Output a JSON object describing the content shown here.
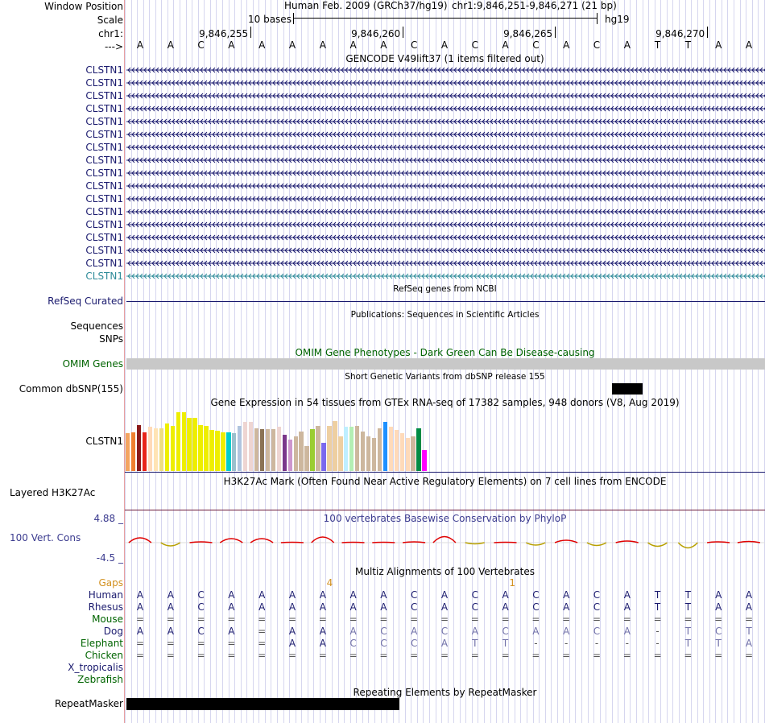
{
  "header": {
    "window_position_label": "Window Position",
    "scale_label": "Scale",
    "chrom_label": "chr1:",
    "strand_label": "--->",
    "assembly": "Human Feb. 2009 (GRCh37/hg19)",
    "position": "chr1:9,846,251-9,846,271 (21 bp)",
    "scale_text": "10 bases",
    "db_label": "hg19",
    "ticks": [
      "9,846,255",
      "9,846,260",
      "9,846,265",
      "9,846,270"
    ]
  },
  "sequence": [
    "A",
    "A",
    "C",
    "A",
    "A",
    "A",
    "A",
    "A",
    "A",
    "C",
    "A",
    "C",
    "A",
    "C",
    "A",
    "C",
    "A",
    "T",
    "T",
    "A",
    "A"
  ],
  "gencode": {
    "title": "GENCODE V49lift37 (1 items filtered out)",
    "transcripts": [
      "CLSTN1",
      "CLSTN1",
      "CLSTN1",
      "CLSTN1",
      "CLSTN1",
      "CLSTN1",
      "CLSTN1",
      "CLSTN1",
      "CLSTN1",
      "CLSTN1",
      "CLSTN1",
      "CLSTN1",
      "CLSTN1",
      "CLSTN1",
      "CLSTN1",
      "CLSTN1",
      "CLSTN1"
    ],
    "color": "#1a1a6e",
    "last_color": "#2e8b99"
  },
  "refseq": {
    "title": "RefSeq genes from NCBI",
    "label": "RefSeq Curated"
  },
  "publications": {
    "title": "Publications: Sequences in Scientific Articles",
    "label1": "Sequences",
    "label2": "SNPs"
  },
  "omim": {
    "title": "OMIM Gene Phenotypes - Dark Green Can Be Disease-causing",
    "label": "OMIM Genes",
    "color": "#006400"
  },
  "dbsnp": {
    "title": "Short Genetic Variants from dbSNP release 155",
    "label": "Common dbSNP(155)"
  },
  "gtex": {
    "title": "Gene Expression in 54 tissues from GTEx RNA-seq of 17382 samples, 948 donors (V8, Aug 2019)",
    "label": "CLSTN1",
    "bars": [
      {
        "v": 0.6,
        "c": "#f4a460"
      },
      {
        "v": 0.62,
        "c": "#f08030"
      },
      {
        "v": 0.73,
        "c": "#8b1a1a"
      },
      {
        "v": 0.62,
        "c": "#e8241a"
      },
      {
        "v": 0.7,
        "c": "#ffdab9"
      },
      {
        "v": 0.68,
        "c": "#ffe4b5"
      },
      {
        "v": 0.68,
        "c": "#eedd82"
      },
      {
        "v": 0.75,
        "c": "#eeee00"
      },
      {
        "v": 0.72,
        "c": "#eeee00"
      },
      {
        "v": 0.93,
        "c": "#eeee00"
      },
      {
        "v": 0.93,
        "c": "#eeee00"
      },
      {
        "v": 0.85,
        "c": "#eeee00"
      },
      {
        "v": 0.85,
        "c": "#eeee00"
      },
      {
        "v": 0.73,
        "c": "#eeee00"
      },
      {
        "v": 0.72,
        "c": "#eeee00"
      },
      {
        "v": 0.65,
        "c": "#eeee00"
      },
      {
        "v": 0.64,
        "c": "#eeee00"
      },
      {
        "v": 0.62,
        "c": "#eeee00"
      },
      {
        "v": 0.62,
        "c": "#00cdcd"
      },
      {
        "v": 0.6,
        "c": "#9ac0cd"
      },
      {
        "v": 0.72,
        "c": "#b0c4de"
      },
      {
        "v": 0.78,
        "c": "#eed5d2"
      },
      {
        "v": 0.78,
        "c": "#eed5d2"
      },
      {
        "v": 0.68,
        "c": "#cdb79e"
      },
      {
        "v": 0.67,
        "c": "#8b7355"
      },
      {
        "v": 0.67,
        "c": "#cdb79e"
      },
      {
        "v": 0.67,
        "c": "#cdb79e"
      },
      {
        "v": 0.7,
        "c": "#eed5d2"
      },
      {
        "v": 0.58,
        "c": "#7a378b"
      },
      {
        "v": 0.5,
        "c": "#cd96cd"
      },
      {
        "v": 0.55,
        "c": "#cdb79e"
      },
      {
        "v": 0.63,
        "c": "#cdb79e"
      },
      {
        "v": 0.4,
        "c": "#cdb79e"
      },
      {
        "v": 0.67,
        "c": "#9acd32"
      },
      {
        "v": 0.72,
        "c": "#cdb79e"
      },
      {
        "v": 0.45,
        "c": "#7b68ee"
      },
      {
        "v": 0.72,
        "c": "#eecfa1"
      },
      {
        "v": 0.8,
        "c": "#eecfa1"
      },
      {
        "v": 0.55,
        "c": "#eecfa1"
      },
      {
        "v": 0.7,
        "c": "#bfefff"
      },
      {
        "v": 0.7,
        "c": "#b4eeb4"
      },
      {
        "v": 0.72,
        "c": "#cdb79e"
      },
      {
        "v": 0.63,
        "c": "#cdb79e"
      },
      {
        "v": 0.55,
        "c": "#cdb79e"
      },
      {
        "v": 0.52,
        "c": "#cdb79e"
      },
      {
        "v": 0.68,
        "c": "#cdb79e"
      },
      {
        "v": 0.78,
        "c": "#1e90ff"
      },
      {
        "v": 0.7,
        "c": "#ffdab9"
      },
      {
        "v": 0.65,
        "c": "#ffdab9"
      },
      {
        "v": 0.6,
        "c": "#ffdab9"
      },
      {
        "v": 0.52,
        "c": "#ffdab9"
      },
      {
        "v": 0.55,
        "c": "#cdb79e"
      },
      {
        "v": 0.68,
        "c": "#008b45"
      },
      {
        "v": 0.33,
        "c": "#ff00ff"
      }
    ]
  },
  "h3k27ac": {
    "title": "H3K27Ac Mark (Often Found Near Active Regulatory Elements) on 7 cell lines from ENCODE",
    "label": "Layered H3K27Ac"
  },
  "phylop": {
    "title": "100 vertebrates Basewise Conservation by PhyloP",
    "label": "100 Vert. Cons",
    "ymax": "4.88 _",
    "ymin": "-4.5 _",
    "scores": [
      1.2,
      -0.8,
      0.2,
      1.0,
      1.0,
      0.1,
      1.4,
      0.1,
      0.1,
      0.2,
      1.5,
      -0.3,
      0.1,
      -0.6,
      0.6,
      -0.7,
      0.4,
      -0.9,
      -1.3,
      0.2,
      0.3
    ]
  },
  "multiz": {
    "title": "Multiz Alignments of 100 Vertebrates",
    "gaps_label": "Gaps",
    "gap_marks": [
      {
        "pos": 7,
        "text": "4"
      },
      {
        "pos": 13,
        "text": "1"
      }
    ],
    "species": [
      {
        "name": "Human",
        "color": "#1a1a6e",
        "seq": [
          "A",
          "A",
          "C",
          "A",
          "A",
          "A",
          "A",
          "A",
          "A",
          "C",
          "A",
          "C",
          "A",
          "C",
          "A",
          "C",
          "A",
          "T",
          "T",
          "A",
          "A"
        ]
      },
      {
        "name": "Rhesus",
        "color": "#1a1a6e",
        "seq": [
          "A",
          "A",
          "C",
          "A",
          "A",
          "A",
          "A",
          "A",
          "A",
          "C",
          "A",
          "C",
          "A",
          "C",
          "A",
          "C",
          "A",
          "T",
          "T",
          "A",
          "A"
        ]
      },
      {
        "name": "Mouse",
        "color": "#006400",
        "seq": [
          "=",
          "=",
          "=",
          "=",
          "=",
          "=",
          "=",
          "=",
          "=",
          "=",
          "=",
          "=",
          "=",
          "=",
          "=",
          "=",
          "=",
          "=",
          "=",
          "=",
          "="
        ]
      },
      {
        "name": "Dog",
        "color": "#1a1a6e",
        "seq": [
          "A",
          "A",
          "C",
          "A",
          "=",
          "A",
          "A",
          "A",
          "C",
          "A",
          "C",
          "A",
          "C",
          "A",
          "A",
          "C",
          "A",
          "-",
          "T",
          "C",
          "T"
        ]
      },
      {
        "name": "Elephant",
        "color": "#006400",
        "seq": [
          "=",
          "=",
          "=",
          "=",
          "=",
          "A",
          "A",
          "|C",
          "C",
          "C",
          "A",
          "T",
          "T",
          "-",
          "-",
          "-",
          "-",
          "-",
          "T",
          "T",
          "A"
        ]
      },
      {
        "name": "Chicken",
        "color": "#006400",
        "seq": [
          "=",
          "=",
          "=",
          "=",
          "=",
          "=",
          "=",
          "=",
          "=",
          "=",
          "=",
          "=",
          "=",
          "=",
          "=",
          "=",
          "=",
          "=",
          "=",
          "=",
          "="
        ]
      },
      {
        "name": "X_tropicalis",
        "color": "#1a1a6e",
        "seq": [
          "",
          "",
          "",
          "",
          "",
          "",
          "",
          "",
          "",
          "",
          "",
          "",
          "",
          "",
          "",
          "",
          "",
          "",
          "",
          "",
          ""
        ]
      },
      {
        "name": "Zebrafish",
        "color": "#006400",
        "seq": [
          "",
          "",
          "",
          "",
          "",
          "",
          "",
          "",
          "",
          "",
          "",
          "",
          "",
          "",
          "",
          "",
          "",
          "",
          "",
          "",
          ""
        ]
      }
    ]
  },
  "repeatmasker": {
    "title": "Repeating Elements by RepeatMasker",
    "label": "RepeatMasker"
  }
}
